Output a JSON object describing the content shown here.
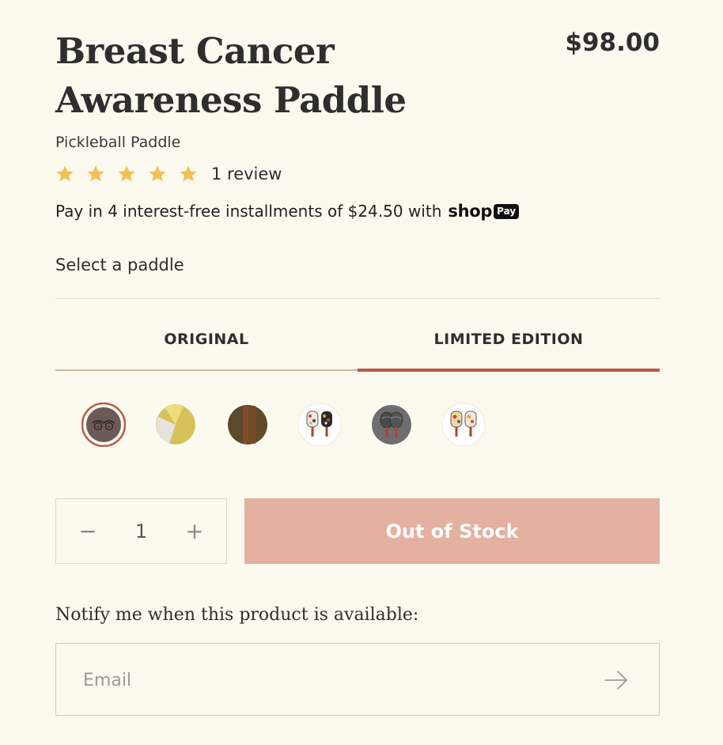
{
  "product": {
    "title": "Breast Cancer Awareness Paddle",
    "price": "$98.00",
    "subtitle": "Pickleball Paddle",
    "rating": 5,
    "review_text": "1 review"
  },
  "installments": {
    "text": "Pay in 4 interest-free installments of $24.50 with",
    "shop_text": "shop",
    "pay_badge": "Pay"
  },
  "selector": {
    "label": "Select a paddle",
    "tabs": [
      {
        "label": "ORIGINAL",
        "active": false
      },
      {
        "label": "LIMITED EDITION",
        "active": true
      }
    ],
    "swatches": [
      {
        "name": "swatch-brown-figure",
        "selected": true,
        "color": "#6b5a55"
      },
      {
        "name": "swatch-yellow-grey",
        "selected": false,
        "color": "#d6c259"
      },
      {
        "name": "swatch-olive-rust",
        "selected": false,
        "color": "#5a4a2a"
      },
      {
        "name": "swatch-pattern-paddles",
        "selected": false,
        "color": "#e8d8c8"
      },
      {
        "name": "swatch-grey-paddles",
        "selected": false,
        "color": "#6e6e6e"
      },
      {
        "name": "swatch-colorful-paddles",
        "selected": false,
        "color": "#f0d79a"
      }
    ]
  },
  "cart": {
    "quantity": "1",
    "minus": "−",
    "plus": "+",
    "button_label": "Out of Stock"
  },
  "notify": {
    "label": "Notify me when this product is available:",
    "email_placeholder": "Email"
  },
  "colors": {
    "background": "#fcf9ee",
    "star": "#f2c054",
    "accent": "#b85a45",
    "oos_button": "#e4b0a0"
  },
  "icons": {
    "star": "star-icon",
    "arrow": "arrow-right-icon"
  }
}
